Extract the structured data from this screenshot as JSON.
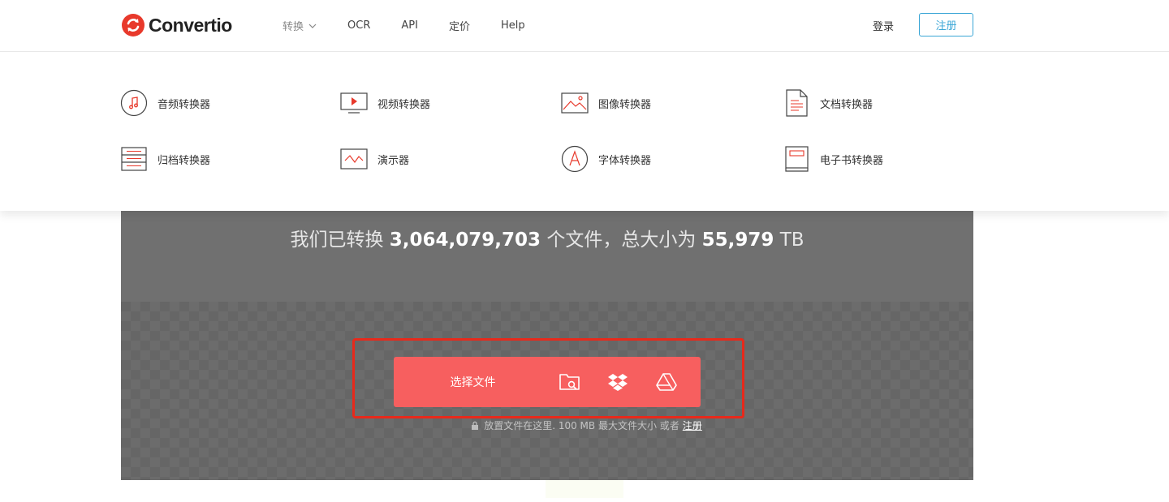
{
  "brand": {
    "name": "Convertio",
    "accent": "#e8392b"
  },
  "nav": {
    "items": [
      {
        "label": "转换",
        "has_dropdown": true
      },
      {
        "label": "OCR"
      },
      {
        "label": "API"
      },
      {
        "label": "定价"
      },
      {
        "label": "Help"
      }
    ],
    "login": "登录",
    "signup": "注册"
  },
  "dropdown": {
    "items": [
      {
        "label": "音频转换器",
        "icon": "music-note-icon"
      },
      {
        "label": "视频转换器",
        "icon": "video-play-icon"
      },
      {
        "label": "图像转换器",
        "icon": "image-icon"
      },
      {
        "label": "文档转换器",
        "icon": "document-icon"
      },
      {
        "label": "归档转换器",
        "icon": "archive-icon"
      },
      {
        "label": "演示器",
        "icon": "presentation-icon"
      },
      {
        "label": "字体转换器",
        "icon": "font-icon"
      },
      {
        "label": "电子书转换器",
        "icon": "ebook-icon"
      }
    ]
  },
  "stats": {
    "prefix": "我们已转换",
    "files_count": "3,064,079,703",
    "middle": "个文件，总大小为",
    "size": "55,979",
    "unit": "TB"
  },
  "upload": {
    "choose_label": "选择文件",
    "icons": [
      "folder-search-icon",
      "dropbox-icon",
      "google-drive-icon"
    ],
    "bar_color": "#f75f5f"
  },
  "hint": {
    "text": "放置文件在这里. 100 MB 最大文件大小 或者",
    "link": "注册"
  }
}
